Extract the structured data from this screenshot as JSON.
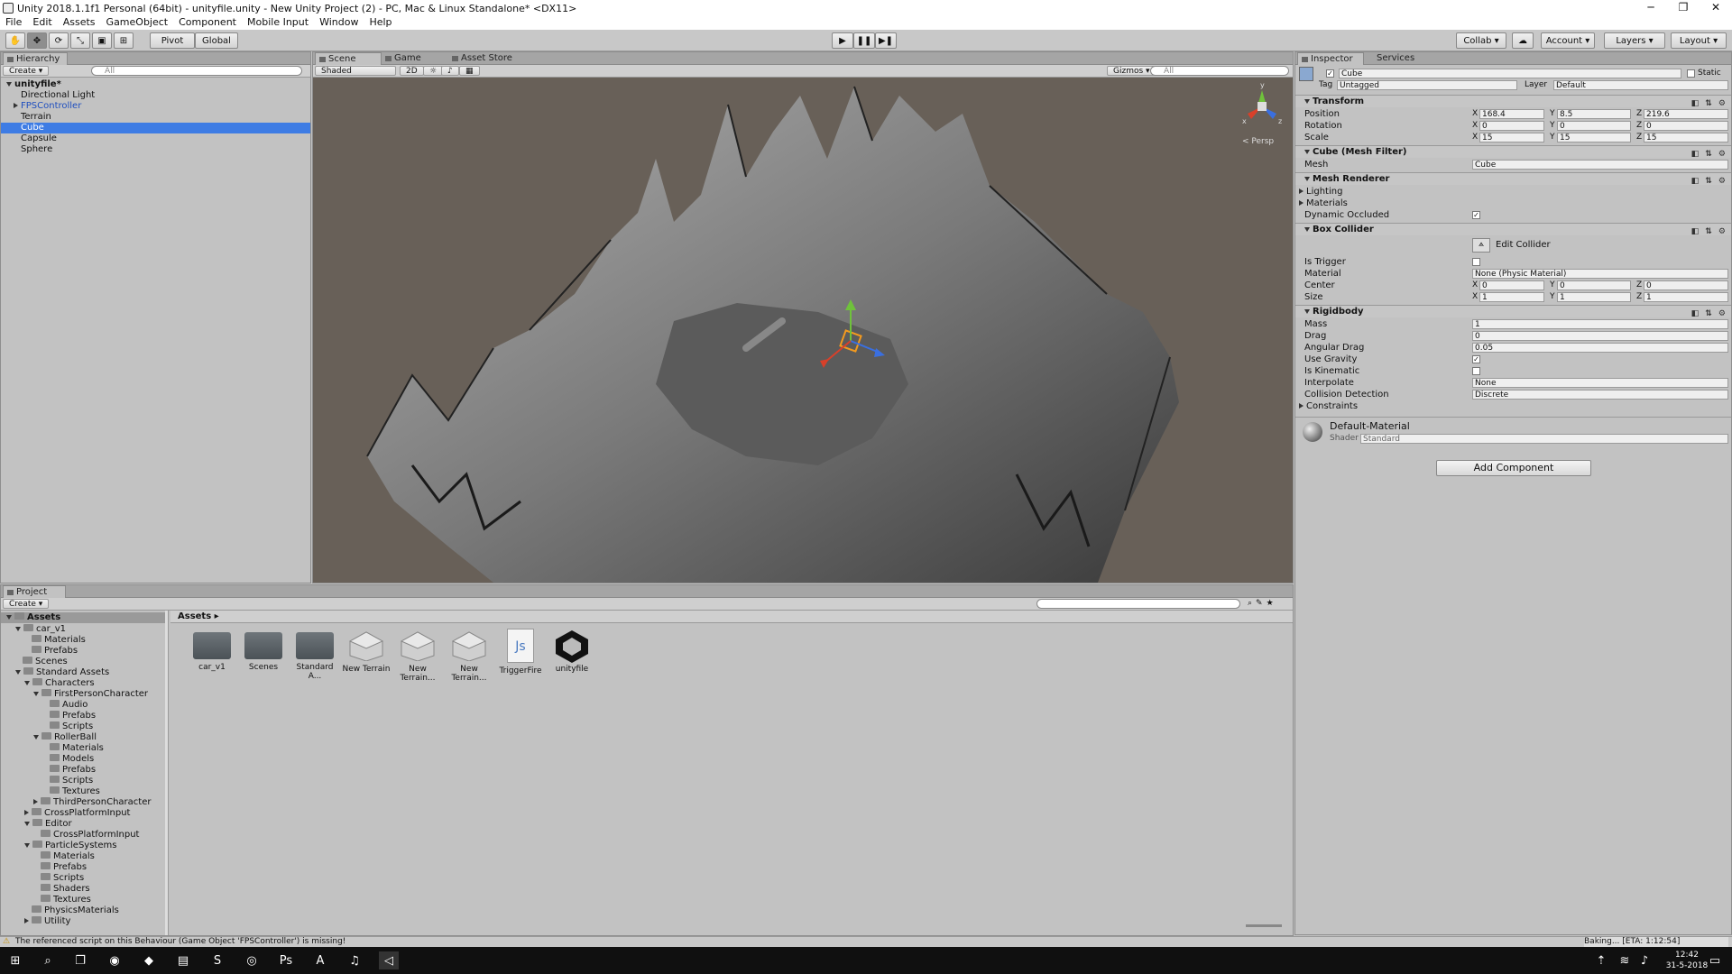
{
  "window": {
    "title": "Unity 2018.1.1f1 Personal (64bit) - unityfile.unity - New Unity Project (2) - PC, Mac & Linux Standalone* <DX11>",
    "controls": [
      "─",
      "❐",
      "✕"
    ]
  },
  "menu": [
    "File",
    "Edit",
    "Assets",
    "GameObject",
    "Component",
    "Mobile Input",
    "Window",
    "Help"
  ],
  "toolbar": {
    "pivot": "Pivot",
    "global": "Global",
    "collab": "Collab ▾",
    "account": "Account",
    "layers": "Layers",
    "layout": "Layout"
  },
  "hierarchy": {
    "tab": "Hierarchy",
    "create": "Create ▾",
    "search_placeholder": "All",
    "scene": "unityfile*",
    "items": [
      "Directional Light",
      "FPSController",
      "Terrain",
      "Cube",
      "Capsule",
      "Sphere"
    ],
    "selected": "Cube",
    "prefab_color": "#1f4fbf"
  },
  "scene_view": {
    "tabs": [
      "Scene",
      "Game",
      "Asset Store"
    ],
    "shading": "Shaded",
    "mode_2d": "2D",
    "gizmos": "Gizmos ▾",
    "search_placeholder": "All",
    "persp": "< Persp",
    "gizmo_axes": {
      "y": "y",
      "x": "x",
      "z": "z"
    }
  },
  "inspector": {
    "tabs": [
      "Inspector",
      "Services"
    ],
    "object_name": "Cube",
    "static": "Static",
    "tag_label": "Tag",
    "tag": "Untagged",
    "layer_label": "Layer",
    "layer": "Default",
    "transform": {
      "title": "Transform",
      "rows": [
        {
          "label": "Position",
          "x": "168.4",
          "y": "8.5",
          "z": "219.6"
        },
        {
          "label": "Rotation",
          "x": "0",
          "y": "0",
          "z": "0"
        },
        {
          "label": "Scale",
          "x": "15",
          "y": "15",
          "z": "15"
        }
      ]
    },
    "mesh_filter": {
      "title": "Cube (Mesh Filter)",
      "mesh_label": "Mesh",
      "mesh": "Cube"
    },
    "mesh_renderer": {
      "title": "Mesh Renderer",
      "rows": [
        "Lighting",
        "Materials"
      ],
      "dynamic_occluded": "Dynamic Occluded"
    },
    "box_collider": {
      "title": "Box Collider",
      "edit": "Edit Collider",
      "is_trigger": "Is Trigger",
      "material_label": "Material",
      "material": "None (Physic Material)",
      "center": {
        "label": "Center",
        "x": "0",
        "y": "0",
        "z": "0"
      },
      "size": {
        "label": "Size",
        "x": "1",
        "y": "1",
        "z": "1"
      }
    },
    "rigidbody": {
      "title": "Rigidbody",
      "mass_label": "Mass",
      "mass": "1",
      "drag_label": "Drag",
      "drag": "0",
      "angular_drag_label": "Angular Drag",
      "angular_drag": "0.05",
      "use_gravity": "Use Gravity",
      "is_kinematic": "Is Kinematic",
      "interpolate_label": "Interpolate",
      "interpolate": "None",
      "collision_label": "Collision Detection",
      "collision": "Discrete",
      "constraints": "Constraints"
    },
    "material": {
      "name": "Default-Material",
      "shader_label": "Shader",
      "shader": "Standard"
    },
    "add_component": "Add Component"
  },
  "project": {
    "tab": "Project",
    "create": "Create ▾",
    "root": "Assets",
    "breadcrumb": "Assets ▸",
    "tree": [
      {
        "t": "car_v1",
        "d": 1,
        "open": true
      },
      {
        "t": "Materials",
        "d": 2
      },
      {
        "t": "Prefabs",
        "d": 2
      },
      {
        "t": "Scenes",
        "d": 1
      },
      {
        "t": "Standard Assets",
        "d": 1,
        "open": true
      },
      {
        "t": "Characters",
        "d": 2,
        "open": true
      },
      {
        "t": "FirstPersonCharacter",
        "d": 3,
        "open": true
      },
      {
        "t": "Audio",
        "d": 4
      },
      {
        "t": "Prefabs",
        "d": 4
      },
      {
        "t": "Scripts",
        "d": 4
      },
      {
        "t": "RollerBall",
        "d": 3,
        "open": true
      },
      {
        "t": "Materials",
        "d": 4
      },
      {
        "t": "Models",
        "d": 4
      },
      {
        "t": "Prefabs",
        "d": 4
      },
      {
        "t": "Scripts",
        "d": 4
      },
      {
        "t": "Textures",
        "d": 4
      },
      {
        "t": "ThirdPersonCharacter",
        "d": 3,
        "closed": true
      },
      {
        "t": "CrossPlatformInput",
        "d": 2,
        "closed": true
      },
      {
        "t": "Editor",
        "d": 2,
        "open": true
      },
      {
        "t": "CrossPlatformInput",
        "d": 3
      },
      {
        "t": "ParticleSystems",
        "d": 2,
        "open": true
      },
      {
        "t": "Materials",
        "d": 3
      },
      {
        "t": "Prefabs",
        "d": 3
      },
      {
        "t": "Scripts",
        "d": 3
      },
      {
        "t": "Shaders",
        "d": 3
      },
      {
        "t": "Textures",
        "d": 3
      },
      {
        "t": "PhysicsMaterials",
        "d": 2
      },
      {
        "t": "Utility",
        "d": 2,
        "closed": true
      }
    ],
    "assets": [
      {
        "name": "car_v1",
        "kind": "folder"
      },
      {
        "name": "Scenes",
        "kind": "folder"
      },
      {
        "name": "Standard A...",
        "kind": "folder"
      },
      {
        "name": "New Terrain",
        "kind": "terrain"
      },
      {
        "name": "New Terrain...",
        "kind": "terrain"
      },
      {
        "name": "New Terrain...",
        "kind": "terrain"
      },
      {
        "name": "TriggerFire",
        "kind": "js"
      },
      {
        "name": "unityfile",
        "kind": "unity"
      }
    ]
  },
  "status": {
    "warning": "The referenced script on this Behaviour (Game Object 'FPSController') is missing!",
    "baking": "Baking... [ETA: 1:12:54]"
  },
  "taskbar": {
    "time": "12:42",
    "date": "31-5-2018"
  }
}
